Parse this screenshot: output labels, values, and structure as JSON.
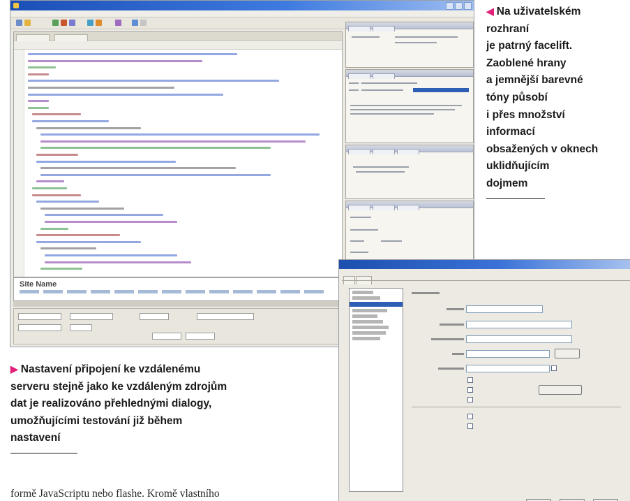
{
  "captions": {
    "ui": {
      "marker": "◀",
      "lines": [
        "Na uživatelském",
        "rozhraní",
        "je patrný facelift.",
        "Zaoblené hrany",
        "a jemnější barevné",
        "tóny působí",
        "i přes množství",
        "informací",
        "obsažených v oknech",
        "uklidňujícím",
        "dojmem"
      ]
    },
    "server": {
      "marker": "▶",
      "lines": [
        "Nastavení připojení ke vzdálenému",
        "serveru stejně jako ke vzdáleným zdrojům",
        "dat je realizováno přehlednými dialogy,",
        "umožňujícími testování již během",
        "nastavení"
      ]
    }
  },
  "body_text": "formě JavaScriptu nebo flashe. Kromě vlastního",
  "ide_screenshot": {
    "preview_site_name": "Site Name"
  },
  "colors": {
    "caption_marker": "#e0207a",
    "titlebar": "#1b4fb6",
    "selection": "#2f5fb5"
  }
}
